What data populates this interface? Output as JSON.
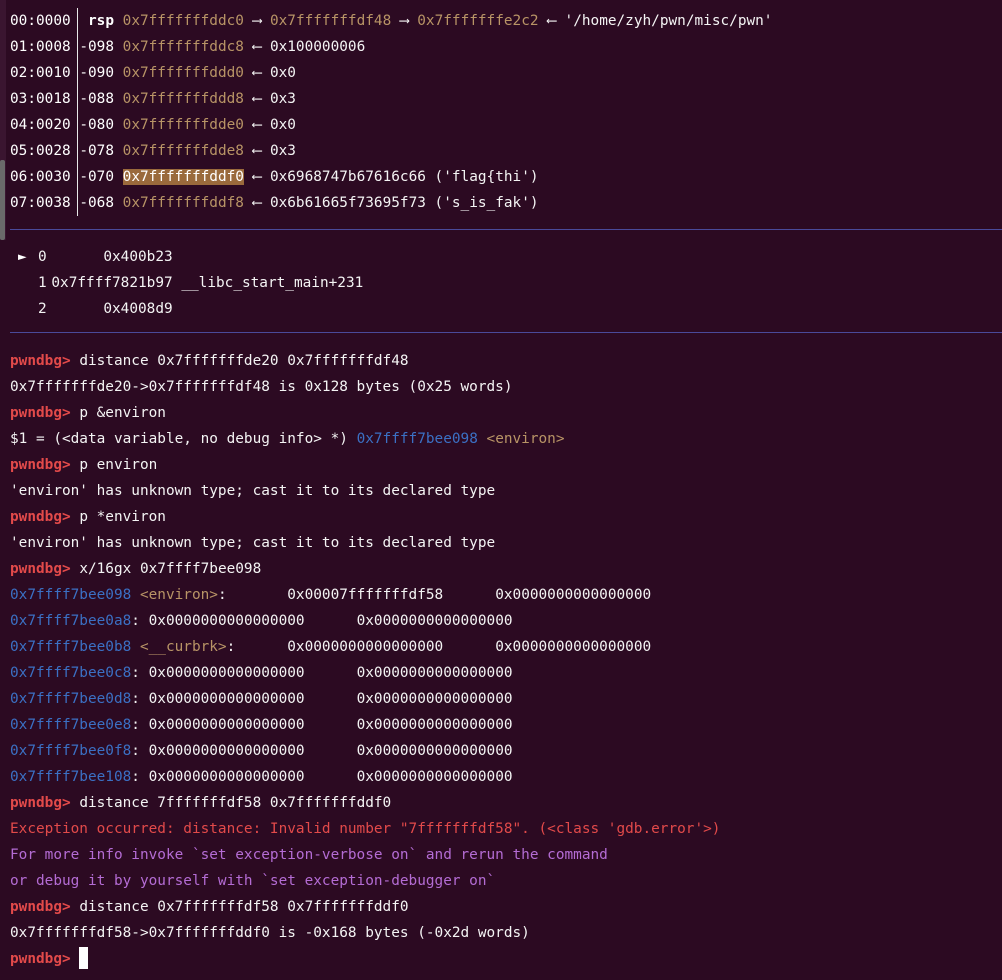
{
  "stack": [
    {
      "idx": "00:0000",
      "off": "rsp",
      "addr": "0x7fffffffddc0",
      "rest_parts": [
        {
          "t": " ⟶ ",
          "c": "white"
        },
        {
          "t": "0x7fffffffdf48",
          "c": "stack"
        },
        {
          "t": " ⟶ ",
          "c": "white"
        },
        {
          "t": "0x7fffffffe2c2",
          "c": "stack"
        },
        {
          "t": " ⟵ '/home/zyh/pwn/misc/pwn'",
          "c": "white"
        }
      ]
    },
    {
      "idx": "01:0008",
      "off": "-098",
      "addr": "0x7fffffffddc8",
      "rest": " ⟵ 0x100000006"
    },
    {
      "idx": "02:0010",
      "off": "-090",
      "addr": "0x7fffffffddd0",
      "rest": " ⟵ 0x0"
    },
    {
      "idx": "03:0018",
      "off": "-088",
      "addr": "0x7fffffffddd8",
      "rest": " ⟵ 0x3"
    },
    {
      "idx": "04:0020",
      "off": "-080",
      "addr": "0x7fffffffdde0",
      "rest": " ⟵ 0x0"
    },
    {
      "idx": "05:0028",
      "off": "-078",
      "addr": "0x7fffffffdde8",
      "rest": " ⟵ 0x3"
    },
    {
      "idx": "06:0030",
      "off": "-070",
      "addr": "0x7fffffffddf0",
      "highlight": true,
      "rest": " ⟵ 0x6968747b67616c66 ('flag{thi')"
    },
    {
      "idx": "07:0038",
      "off": "-068",
      "addr": "0x7fffffffddf8",
      "rest": " ⟵ 0x6b61665f73695f73 ('s_is_fak')"
    }
  ],
  "backtrace": [
    {
      "marker": "►",
      "num": "0",
      "addr": "0x400b23",
      "sym": ""
    },
    {
      "marker": "",
      "num": "1",
      "addr": "0x7ffff7821b97",
      "sym": "__libc_start_main+231"
    },
    {
      "marker": "",
      "num": "2",
      "addr": "0x4008d9",
      "sym": ""
    }
  ],
  "prompt": "pwndbg>",
  "session": {
    "c1": " distance 0x7fffffffde20 0x7fffffffdf48",
    "o1": "0x7fffffffde20->0x7fffffffdf48 is 0x128 bytes (0x25 words)",
    "c2": " p &environ",
    "o2a": "$1 = (<data variable, no debug info> *) ",
    "o2b": "0x7ffff7bee098",
    "o2c": " ",
    "o2d": "<environ>",
    "c3": " p environ",
    "o3": "'environ' has unknown type; cast it to its declared type",
    "c4": " p *environ",
    "o4": "'environ' has unknown type; cast it to its declared type",
    "c5": " x/16gx 0x7ffff7bee098",
    "c6": " distance 7fffffffdf58 0x7fffffffddf0",
    "e1": "Exception occurred: distance: Invalid number \"7fffffffdf58\". (<class 'gdb.error'>)",
    "e2": "For more info invoke `set exception-verbose on` and rerun the command",
    "e3": "or debug it by yourself with `set exception-debugger on`",
    "c7": " distance 0x7fffffffdf58 0x7fffffffddf0",
    "o7": "0x7fffffffdf58->0x7fffffffddf0 is -0x168 bytes (-0x2d words)",
    "final_prompt_tail": " "
  },
  "memdump": [
    {
      "addr": "0x7ffff7bee098",
      "sym": " <environ>",
      "colon": ":",
      "pad": "       ",
      "v1": "0x00007fffffffdf58",
      "v2": "0x0000000000000000"
    },
    {
      "addr": "0x7ffff7bee0a8",
      "sym": "",
      "colon": ":",
      "pad": " ",
      "v1": "0x0000000000000000",
      "v2": "0x0000000000000000"
    },
    {
      "addr": "0x7ffff7bee0b8",
      "sym": " <__curbrk>",
      "colon": ":",
      "pad": "      ",
      "v1": "0x0000000000000000",
      "v2": "0x0000000000000000"
    },
    {
      "addr": "0x7ffff7bee0c8",
      "sym": "",
      "colon": ":",
      "pad": " ",
      "v1": "0x0000000000000000",
      "v2": "0x0000000000000000"
    },
    {
      "addr": "0x7ffff7bee0d8",
      "sym": "",
      "colon": ":",
      "pad": " ",
      "v1": "0x0000000000000000",
      "v2": "0x0000000000000000"
    },
    {
      "addr": "0x7ffff7bee0e8",
      "sym": "",
      "colon": ":",
      "pad": " ",
      "v1": "0x0000000000000000",
      "v2": "0x0000000000000000"
    },
    {
      "addr": "0x7ffff7bee0f8",
      "sym": "",
      "colon": ":",
      "pad": " ",
      "v1": "0x0000000000000000",
      "v2": "0x0000000000000000"
    },
    {
      "addr": "0x7ffff7bee108",
      "sym": "",
      "colon": ":",
      "pad": " ",
      "v1": "0x0000000000000000",
      "v2": "0x0000000000000000"
    }
  ]
}
